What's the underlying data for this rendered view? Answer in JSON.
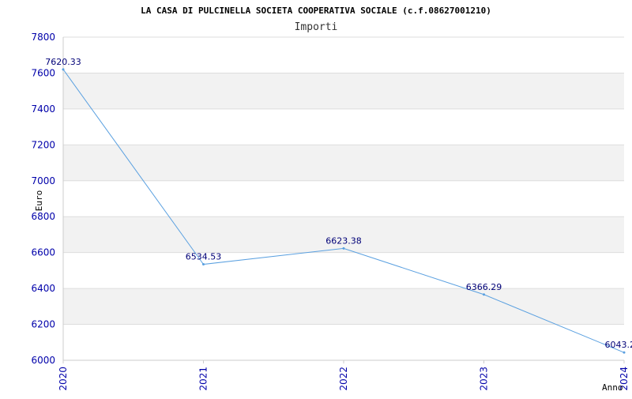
{
  "chart_data": {
    "type": "line",
    "title": "LA CASA DI PULCINELLA SOCIETA COOPERATIVA SOCIALE (c.f.08627001210)",
    "subtitle": "Importi",
    "xlabel": "Anno",
    "ylabel": "Euro",
    "x": [
      "2020",
      "2021",
      "2022",
      "2023",
      "2024"
    ],
    "values": [
      7620.33,
      6534.53,
      6623.38,
      6366.29,
      6043.2
    ],
    "data_labels": [
      "7620.33",
      "6534.53",
      "6623.38",
      "6366.29",
      "6043.2"
    ],
    "ylim": [
      6000,
      7800
    ],
    "yticks": [
      6000,
      6200,
      6400,
      6600,
      6800,
      7000,
      7200,
      7400,
      7600,
      7800
    ],
    "grid": true,
    "colors": {
      "line": "#5aa0e0",
      "band": "#f2f2f2",
      "tick_text": "#0000aa",
      "label_text": "#000077"
    }
  }
}
